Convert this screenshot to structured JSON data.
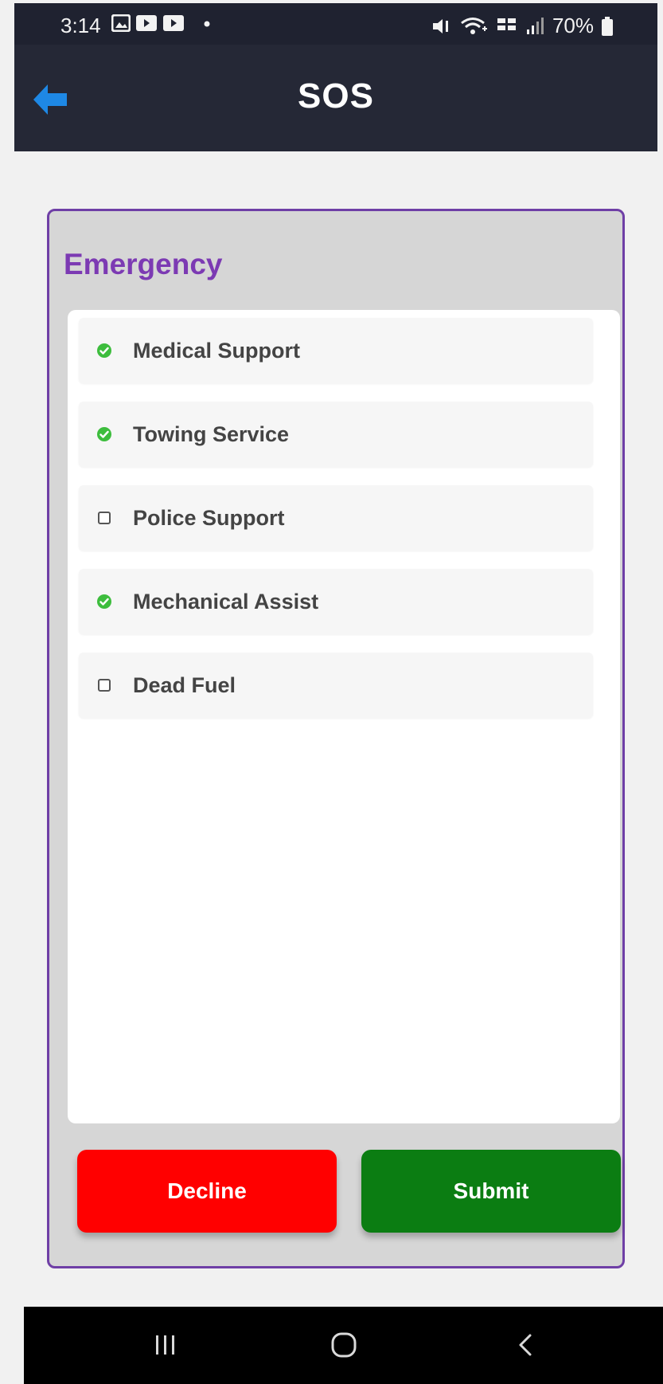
{
  "status_bar": {
    "time": "3:14",
    "battery": "70%"
  },
  "app_bar": {
    "title": "SOS",
    "back_icon": "arrow-left-icon"
  },
  "card": {
    "title": "Emergency",
    "options": [
      {
        "label": "Medical Support",
        "checked": true
      },
      {
        "label": "Towing Service",
        "checked": true
      },
      {
        "label": "Police Support",
        "checked": false
      },
      {
        "label": "Mechanical Assist",
        "checked": true
      },
      {
        "label": "Dead Fuel",
        "checked": false
      }
    ],
    "decline_label": "Decline",
    "submit_label": "Submit"
  },
  "colors": {
    "accent_purple": "#7c3ab3",
    "check_green": "#3dbd3d",
    "decline_red": "#ff0000",
    "submit_green": "#0b7d12",
    "back_blue": "#1e88e5"
  },
  "nav_bar": {
    "icons": [
      "recents-icon",
      "home-icon",
      "back-icon"
    ]
  }
}
